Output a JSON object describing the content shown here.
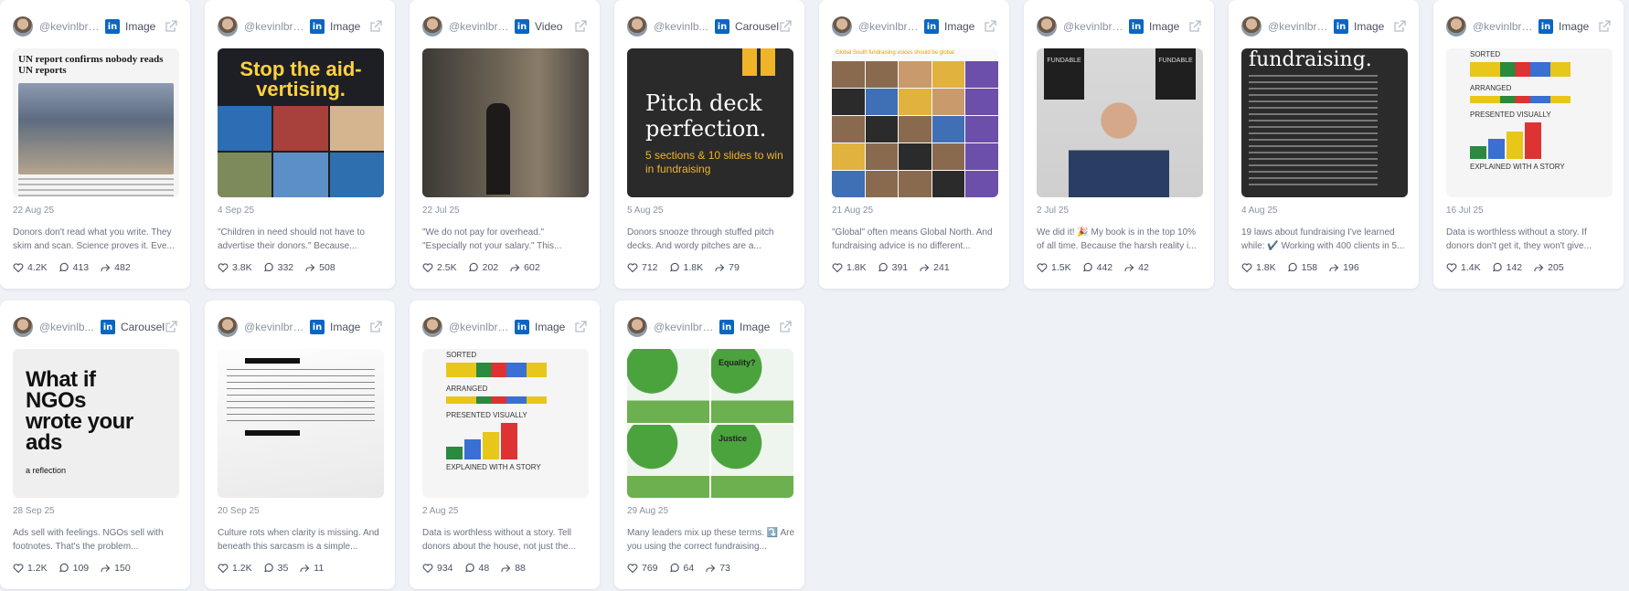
{
  "colors": {
    "background": "#eef1f6",
    "linkedin": "#0a66c2",
    "accent_yellow": "#f0b429"
  },
  "cards": [
    {
      "handle": "@kevinlbro...",
      "type": "Image",
      "date": "22 Aug 25",
      "caption": "Donors don't read what you write. They skim and scan. Science proves it. Eve...",
      "likes": "4.2K",
      "comments": "413",
      "shares": "482",
      "thumb": {
        "kind": "doc",
        "headline": "UN report confirms nobody reads UN reports"
      }
    },
    {
      "handle": "@kevinlbro...",
      "type": "Image",
      "date": "4 Sep 25",
      "caption": "\"Children in need should not have to advertise their donors.\" Because...",
      "likes": "3.8K",
      "comments": "332",
      "shares": "508",
      "thumb": {
        "kind": "aid",
        "headline": "Stop the aid-vertising."
      }
    },
    {
      "handle": "@kevinlbrown",
      "type": "Video",
      "date": "22 Jul 25",
      "caption": "\"We do not pay for overhead.\" \"Especially not your salary.\" This...",
      "likes": "2.5K",
      "comments": "202",
      "shares": "602",
      "thumb": {
        "kind": "street"
      }
    },
    {
      "handle": "@kevinlb...",
      "type": "Carousel",
      "date": "5 Aug 25",
      "caption": "Donors snooze through stuffed pitch decks. And wordy pitches are a...",
      "likes": "712",
      "comments": "1.8K",
      "shares": "79",
      "thumb": {
        "kind": "pitch",
        "headline": "Pitch deck perfection.",
        "sub": "5 sections & 10 slides to win in fundraising"
      }
    },
    {
      "handle": "@kevinlbro...",
      "type": "Image",
      "date": "21 Aug 25",
      "caption": "\"Global\" often means Global North. And fundraising advice is no different...",
      "likes": "1.8K",
      "comments": "391",
      "shares": "241",
      "thumb": {
        "kind": "faces",
        "header": "Global South fundraising voices should be global"
      }
    },
    {
      "handle": "@kevinlbro...",
      "type": "Image",
      "date": "2 Jul 25",
      "caption": "We did it! 🎉 My book is in the top 10% of all time. Because the harsh reality i...",
      "likes": "1.5K",
      "comments": "442",
      "shares": "42",
      "thumb": {
        "kind": "book",
        "book_left": "FUNDABLE",
        "book_right": "FUNDABLE"
      }
    },
    {
      "handle": "@kevinlbro...",
      "type": "Image",
      "date": "4 Aug 25",
      "caption": "19 laws about fundraising I've learned while: ✔️ Working with 400 clients in 5...",
      "likes": "1.8K",
      "comments": "158",
      "shares": "196",
      "thumb": {
        "kind": "laws",
        "headline": "fundraising."
      }
    },
    {
      "handle": "@kevinlbro...",
      "type": "Image",
      "date": "16 Jul 25",
      "caption": "Data is worthless without a story. If donors don't get it, they won't give...",
      "likes": "1.4K",
      "comments": "142",
      "shares": "205",
      "thumb": {
        "kind": "lego",
        "l1": "SORTED",
        "l2": "ARRANGED",
        "l3": "PRESENTED VISUALLY",
        "l4": "EXPLAINED WITH A STORY"
      }
    },
    {
      "handle": "@kevinlb...",
      "type": "Carousel",
      "date": "28 Sep 25",
      "caption": "Ads sell with feelings. NGOs sell with footnotes. That's the problem...",
      "likes": "1.2K",
      "comments": "109",
      "shares": "150",
      "thumb": {
        "kind": "ngo",
        "headline": "What if NGOs wrote your ads",
        "sub": "a reflection"
      }
    },
    {
      "handle": "@kevinlbro...",
      "type": "Image",
      "date": "20 Sep 25",
      "caption": "Culture rots when clarity is missing. And beneath this sarcasm is a simple...",
      "likes": "1.2K",
      "comments": "35",
      "shares": "11",
      "thumb": {
        "kind": "paper"
      }
    },
    {
      "handle": "@kevinlbro...",
      "type": "Image",
      "date": "2 Aug 25",
      "caption": "Data is worthless without a story. Tell donors about the house, not just the...",
      "likes": "934",
      "comments": "48",
      "shares": "88",
      "thumb": {
        "kind": "lego",
        "l1": "SORTED",
        "l2": "ARRANGED",
        "l3": "PRESENTED VISUALLY",
        "l4": "EXPLAINED WITH A STORY"
      }
    },
    {
      "handle": "@kevinlbro...",
      "type": "Image",
      "date": "29 Aug 25",
      "caption": "Many leaders mix up these terms. ⤵️ Are you using the correct fundraising...",
      "likes": "769",
      "comments": "64",
      "shares": "73",
      "thumb": {
        "kind": "tree",
        "label1": "Equality?",
        "label2": "Justice"
      }
    }
  ]
}
